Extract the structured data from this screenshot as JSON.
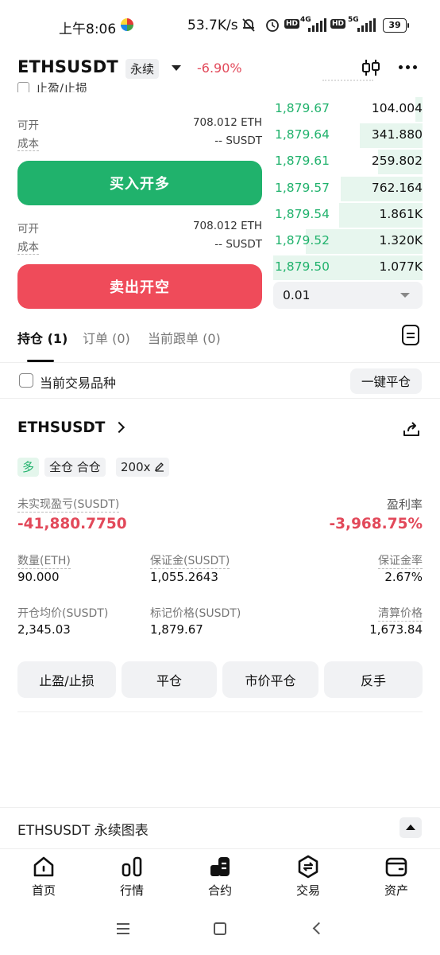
{
  "status_bar": {
    "time": "上午8:06",
    "net_speed": "53.7K/s",
    "sim1_label": "4G",
    "sim2_label": "5G",
    "hd_label": "HD",
    "battery": "39"
  },
  "header": {
    "symbol": "ETHSUSDT",
    "contract_type": "永续",
    "change_pct": "-6.90%"
  },
  "trade_panel": {
    "tpsl_label": "止盈/止损",
    "buy_block": {
      "available_label": "可开",
      "available_value": "708.012 ETH",
      "cost_label": "成本",
      "cost_value": "-- SUSDT",
      "button_label": "买入开多"
    },
    "sell_block": {
      "available_label": "可开",
      "available_value": "708.012 ETH",
      "cost_label": "成本",
      "cost_value": "-- SUSDT",
      "button_label": "卖出开空"
    }
  },
  "order_book": {
    "rows": [
      {
        "price": "1,879.67",
        "qty": "104.004",
        "depth": 0.05
      },
      {
        "price": "1,879.64",
        "qty": "341.880",
        "depth": 0.42
      },
      {
        "price": "1,879.61",
        "qty": "259.802",
        "depth": 0.3
      },
      {
        "price": "1,879.57",
        "qty": "762.164",
        "depth": 0.55
      },
      {
        "price": "1,879.54",
        "qty": "1.861K",
        "depth": 0.56
      },
      {
        "price": "1,879.52",
        "qty": "1.320K",
        "depth": 0.78
      },
      {
        "price": "1,879.50",
        "qty": "1.077K",
        "depth": 1.0
      }
    ],
    "precision": "0.01"
  },
  "tabs": {
    "positions": "持仓 (1)",
    "orders": "订单 (0)",
    "copy_orders": "当前跟单 (0)"
  },
  "filter": {
    "current_symbol_label": "当前交易品种",
    "close_all_label": "一键平仓"
  },
  "position": {
    "symbol": "ETHSUSDT",
    "side_tag": "多",
    "margin_mode_tag": "全仓 合仓",
    "leverage_tag": "200x",
    "unrealized_pnl_label": "未实现盈亏(SUSDT)",
    "unrealized_pnl_value": "-41,880.7750",
    "roi_label": "盈利率",
    "roi_value": "-3,968.75%",
    "qty_label": "数量(ETH)",
    "qty_value": "90.000",
    "margin_label": "保证金(SUSDT)",
    "margin_value": "1,055.2643",
    "margin_ratio_label": "保证金率",
    "margin_ratio_value": "2.67%",
    "entry_label": "开仓均价(SUSDT)",
    "entry_value": "2,345.03",
    "mark_label": "标记价格(SUSDT)",
    "mark_value": "1,879.67",
    "liq_label": "清算价格",
    "liq_value": "1,673.84",
    "actions": {
      "tpsl": "止盈/止损",
      "close": "平仓",
      "market_close": "市价平仓",
      "reverse": "反手"
    }
  },
  "chart_bar": {
    "title": "ETHSUSDT 永续图表"
  },
  "bottom_nav": {
    "home": "首页",
    "markets": "行情",
    "futures": "合约",
    "trade": "交易",
    "assets": "资产"
  },
  "colors": {
    "buy": "#20b26c",
    "sell": "#ef4b5a",
    "negative_text": "#e2495a"
  }
}
